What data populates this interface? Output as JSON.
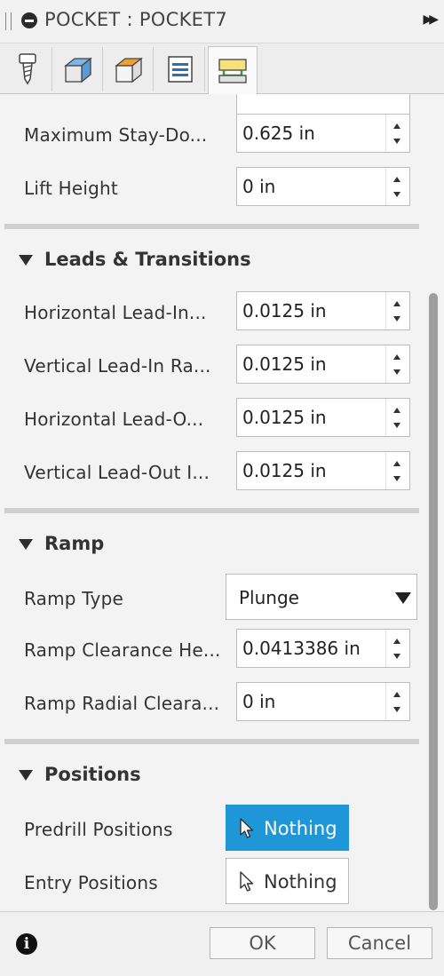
{
  "dialog": {
    "title": "POCKET : POCKET7"
  },
  "tabs": [
    {
      "name": "tool-tab",
      "icon": "tool-icon"
    },
    {
      "name": "geometry-tab",
      "icon": "geometry-icon"
    },
    {
      "name": "heights-tab",
      "icon": "heights-icon"
    },
    {
      "name": "passes-tab",
      "icon": "passes-icon"
    },
    {
      "name": "linking-tab",
      "icon": "linking-icon",
      "active": true
    }
  ],
  "linking": {
    "max_stay_down": {
      "label": "Maximum Stay-Do...",
      "value": "0.625 in"
    },
    "lift_height": {
      "label": "Lift Height",
      "value": "0 in"
    }
  },
  "leads": {
    "title": "Leads & Transitions",
    "fields": [
      {
        "label": "Horizontal Lead-In...",
        "value": "0.0125 in"
      },
      {
        "label": "Vertical Lead-In Ra...",
        "value": "0.0125 in"
      },
      {
        "label": "Horizontal Lead-O...",
        "value": "0.0125 in"
      },
      {
        "label": "Vertical Lead-Out I...",
        "value": "0.0125 in"
      }
    ]
  },
  "ramp": {
    "title": "Ramp",
    "type_label": "Ramp Type",
    "type_value": "Plunge",
    "clearance_label": "Ramp Clearance He...",
    "clearance_value": "0.0413386 in",
    "radial_label": "Ramp Radial Cleara...",
    "radial_value": "0 in"
  },
  "positions": {
    "title": "Positions",
    "predrill_label": "Predrill Positions",
    "predrill_value": "Nothing",
    "entry_label": "Entry Positions",
    "entry_value": "Nothing"
  },
  "footer": {
    "ok": "OK",
    "cancel": "Cancel"
  },
  "colors": {
    "accent": "#1f96d8"
  }
}
